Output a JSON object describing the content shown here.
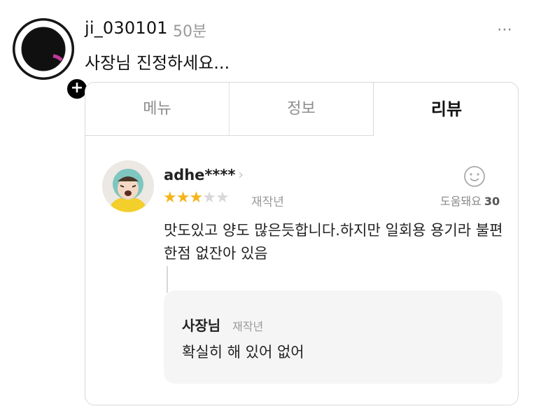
{
  "post": {
    "username": "ji_030101",
    "time": "50분",
    "text": "사장님 진정하세요...",
    "more_icon": "⋯",
    "follow_badge": "+"
  },
  "card": {
    "tabs": [
      {
        "label": "메뉴",
        "active": false
      },
      {
        "label": "정보",
        "active": false
      },
      {
        "label": "리뷰",
        "active": true
      }
    ],
    "review": {
      "author": "adhe****",
      "rating": 3,
      "max_rating": 5,
      "date": "재작년",
      "helpful_label": "도움돼요",
      "helpful_count": "30",
      "text": "맛도있고 양도 많은듯합니다.하지만 일회용 용기라 불편한점 없잔아 있음"
    },
    "reply": {
      "author": "사장님",
      "date": "재작년",
      "text": "확실히 해 있어 없어"
    }
  },
  "colors": {
    "star_on": "#f5b41a",
    "star_off": "#d8d8d8",
    "reply_bg": "#f5f5f5"
  }
}
